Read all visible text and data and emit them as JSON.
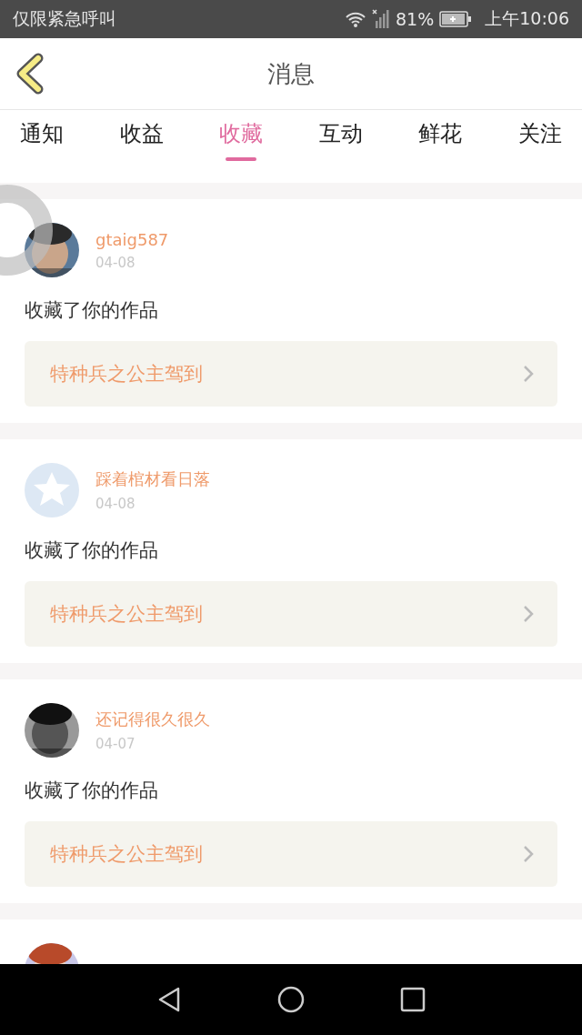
{
  "status_bar": {
    "carrier": "仅限紧急呼叫",
    "battery": "81%",
    "time": "上午10:06"
  },
  "header": {
    "title": "消息"
  },
  "tabs": [
    {
      "label": "通知",
      "selected": false
    },
    {
      "label": "收益",
      "selected": false
    },
    {
      "label": "收藏",
      "selected": true
    },
    {
      "label": "互动",
      "selected": false
    },
    {
      "label": "鲜花",
      "selected": false
    },
    {
      "label": "关注",
      "selected": false
    }
  ],
  "messages": [
    {
      "user": "gtaig587",
      "date": "04-08",
      "kind": "picture",
      "text": "收藏了你的作品",
      "work": "特种兵之公主驾到"
    },
    {
      "user": "踩着棺材看日落",
      "date": "04-08",
      "kind": "default",
      "text": "收藏了你的作品",
      "work": "特种兵之公主驾到"
    },
    {
      "user": "还记得很久很久",
      "date": "04-07",
      "kind": "picture",
      "text": "收藏了你的作品",
      "work": "特种兵之公主驾到"
    },
    {
      "kind": "picture"
    }
  ]
}
